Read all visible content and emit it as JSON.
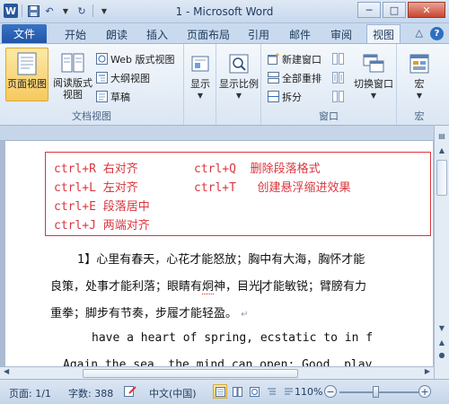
{
  "window": {
    "title": "1 - Microsoft Word",
    "logo_letter": "W",
    "undo_glyph": "↶",
    "redo_glyph": "↻",
    "min_glyph": "─",
    "max_glyph": "□",
    "close_glyph": "✕"
  },
  "tabs": {
    "file": "文件",
    "items": [
      "开始",
      "朗读",
      "插入",
      "页面布局",
      "引用",
      "邮件",
      "审阅",
      "视图"
    ],
    "active": "视图",
    "help_glyph": "?",
    "collapse_glyph": "△"
  },
  "ribbon": {
    "doc_views": {
      "label": "文档视图",
      "page_view": "页面视图",
      "reading_view_line1": "阅读版式",
      "reading_view_line2": "视图",
      "web_view": "Web 版式视图",
      "outline_view": "大纲视图",
      "draft_view": "草稿"
    },
    "show": {
      "label": "显示"
    },
    "zoom": {
      "label": "显示比例"
    },
    "window": {
      "label": "窗口",
      "new_window": "新建窗口",
      "arrange_all": "全部重排",
      "split": "拆分",
      "switch_windows": "切换窗口"
    },
    "macros": {
      "label": "宏",
      "button": "宏"
    }
  },
  "document": {
    "shortcuts": [
      {
        "key": "ctrl+R",
        "desc": "右对齐"
      },
      {
        "key": "ctrl+L",
        "desc": "左对齐"
      },
      {
        "key": "ctrl+E",
        "desc": "段落居中"
      },
      {
        "key": "ctrl+J",
        "desc": "两端对齐"
      },
      {
        "key": "ctrl+Q",
        "desc": "删除段落格式"
      },
      {
        "key": "ctrl+T",
        "desc": "创建悬浮缩进效果"
      }
    ],
    "para1_line1": "1】心里有春天，心花才能怒放；胸中有大海，胸怀才能",
    "para1_line2_a": "良策，处事才能利落；眼睛有",
    "para1_line2_squiggle": "炯",
    "para1_line2_b": "神，目光",
    "para1_line2_c": "才能敏锐；臂膀有力",
    "para1_line3": "重拳；脚步有节奏，步履才能轻盈。",
    "para_mark": "↵",
    "en_line1": "have  a  heart  of  spring,  ecstatic  to  in  f",
    "en_line2": "Again  the  sea,  the  mind  can  open;  Good,  play"
  },
  "scroll": {
    "vertical_position": 0.15,
    "horizontal_position": 0.2
  },
  "statusbar": {
    "page": "页面: 1/1",
    "words": "字数: 388",
    "language": "中文(中国)",
    "zoom_percent": "110%",
    "minus_glyph": "−",
    "plus_glyph": "+"
  },
  "colors": {
    "accent": "#2a5699",
    "shortcut_red": "#d9363e",
    "ribbon_bg": "#dbe6f3",
    "selected": "#f6c95e"
  }
}
